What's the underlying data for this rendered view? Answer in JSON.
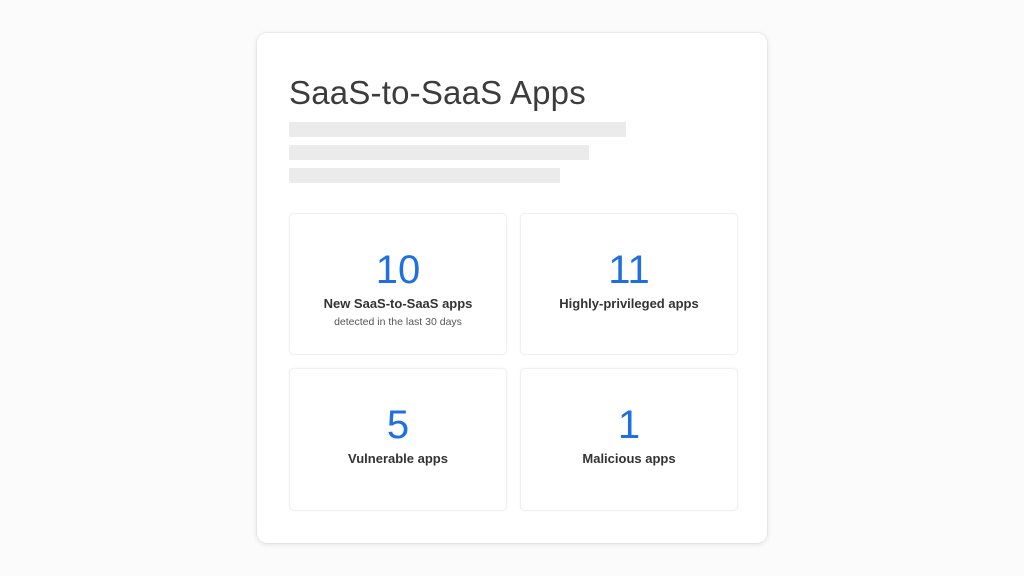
{
  "card": {
    "title": "SaaS-to-SaaS Apps"
  },
  "stats": [
    {
      "value": "10",
      "label": "New SaaS-to-SaaS apps",
      "sublabel": "detected in the last 30 days"
    },
    {
      "value": "11",
      "label": "Highly-privileged apps"
    },
    {
      "value": "5",
      "label": "Vulnerable apps"
    },
    {
      "value": "1",
      "label": "Malicious apps"
    }
  ],
  "colors": {
    "accent": "#1f6fe0",
    "placeholder": "#ebebeb",
    "background": "#fbfbfb",
    "card": "#ffffff"
  }
}
